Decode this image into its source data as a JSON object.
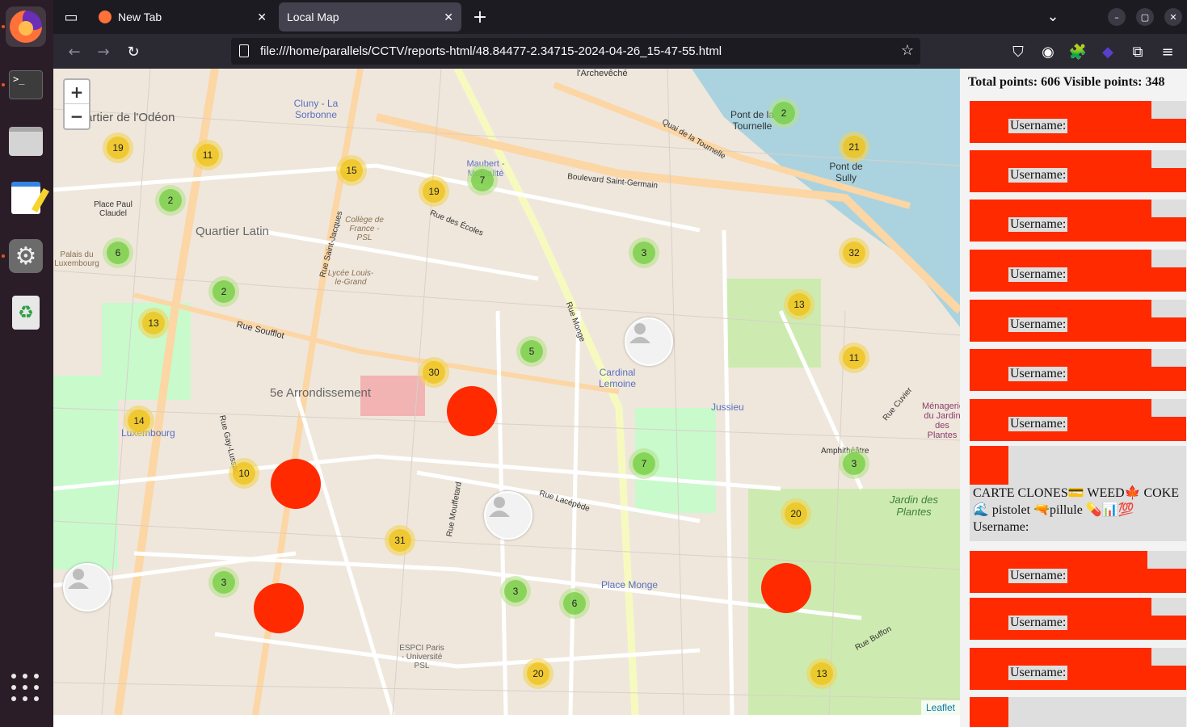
{
  "browser": {
    "tabs": [
      {
        "label": "New Tab",
        "active": false
      },
      {
        "label": "Local Map",
        "active": true
      }
    ],
    "url": "file:///home/parallels/CCTV/reports-html/48.84477-2.34715-2024-04-26_15-47-55.html"
  },
  "dock": {
    "items": [
      "firefox-icon",
      "terminal-icon",
      "files-icon",
      "text-editor-icon",
      "settings-icon",
      "trash-icon"
    ]
  },
  "map": {
    "zoom_in": "+",
    "zoom_out": "−",
    "attribution": "Leaflet",
    "labels": {
      "odeon": "artier de l'Odéon",
      "cluny": "Cluny - La Sorbonne",
      "quartier_latin": "Quartier Latin",
      "arrondissement": "5e Arrondissement",
      "luxembourg": "Luxembourg",
      "cardinal": "Cardinal Lemoine",
      "jussieu": "Jussieu",
      "place_monge": "Place Monge",
      "maubert": "Maubert - Mutualité",
      "pont_tournelle": "Pont de la Tournelle",
      "pont_sully": "Pont de Sully",
      "jardin": "Jardin des Plantes",
      "menagerie": "Ménagerie du Jardin des Plantes",
      "bd_st_germain": "Boulevard Saint-Germain",
      "rue_soufflot": "Rue Soufflot",
      "esplanade": "ESPCI Paris - Université PSL",
      "lycee": "Lycée Louis-le-Grand",
      "college": "Collège de France - PSL",
      "palais": "Palais du Luxembourg",
      "place_paul": "Place Paul Claudel",
      "archeveche": "l'Archevêché",
      "amphitheatre": "Amphithéâtre",
      "rue_monge": "Rue Monge",
      "rue_st_jacques": "Rue Saint-Jacques",
      "rue_gay_lussac": "Rue Gay-Lussac",
      "rue_lacepede": "Rue Lacépède",
      "rue_des_ecoles": "Rue des Écoles",
      "quai_tournelle": "Quai de la Tournelle",
      "rue_mouffetard": "Rue Mouffetard",
      "rue_buffon": "Rue Buffon",
      "rue_cuvier": "Rue Cuvier"
    },
    "clusters": [
      {
        "n": "19",
        "color": "yellow"
      },
      {
        "n": "11",
        "color": "yellow"
      },
      {
        "n": "2",
        "color": "green"
      },
      {
        "n": "15",
        "color": "yellow"
      },
      {
        "n": "19",
        "color": "yellow"
      },
      {
        "n": "7",
        "color": "green"
      },
      {
        "n": "2",
        "color": "green"
      },
      {
        "n": "21",
        "color": "yellow"
      },
      {
        "n": "6",
        "color": "green"
      },
      {
        "n": "3",
        "color": "green"
      },
      {
        "n": "32",
        "color": "yellow"
      },
      {
        "n": "2",
        "color": "green"
      },
      {
        "n": "13",
        "color": "yellow"
      },
      {
        "n": "13",
        "color": "yellow"
      },
      {
        "n": "5",
        "color": "green"
      },
      {
        "n": "30",
        "color": "yellow"
      },
      {
        "n": "11",
        "color": "yellow"
      },
      {
        "n": "14",
        "color": "yellow"
      },
      {
        "n": "10",
        "color": "yellow"
      },
      {
        "n": "7",
        "color": "green"
      },
      {
        "n": "3",
        "color": "green"
      },
      {
        "n": "20",
        "color": "yellow"
      },
      {
        "n": "31",
        "color": "yellow"
      },
      {
        "n": "3",
        "color": "green"
      },
      {
        "n": "3",
        "color": "green"
      },
      {
        "n": "6",
        "color": "green"
      },
      {
        "n": "20",
        "color": "yellow"
      },
      {
        "n": "13",
        "color": "yellow"
      }
    ]
  },
  "sidebar": {
    "totals": "Total points: 606   Visible points: 348",
    "entries": [
      {
        "label": "Username:"
      },
      {
        "label": "Username:"
      },
      {
        "label": "Username:"
      },
      {
        "label": "Username:"
      },
      {
        "label": "Username:"
      },
      {
        "label": "Username:"
      },
      {
        "label": "Username:"
      },
      {
        "label": "Username:"
      },
      {
        "label": "Username:"
      },
      {
        "label": "Username:"
      }
    ],
    "special_entry": {
      "line1": "CARTE CLONES💳 WEED🍁 COKE",
      "line2": "🌊 pistolet 🔫pillule 💊📊💯",
      "label": "Username:"
    }
  },
  "colors": {
    "marker_red": "#ff2a00",
    "cluster_green": "#6ecc39",
    "cluster_yellow": "#f0c20c"
  }
}
